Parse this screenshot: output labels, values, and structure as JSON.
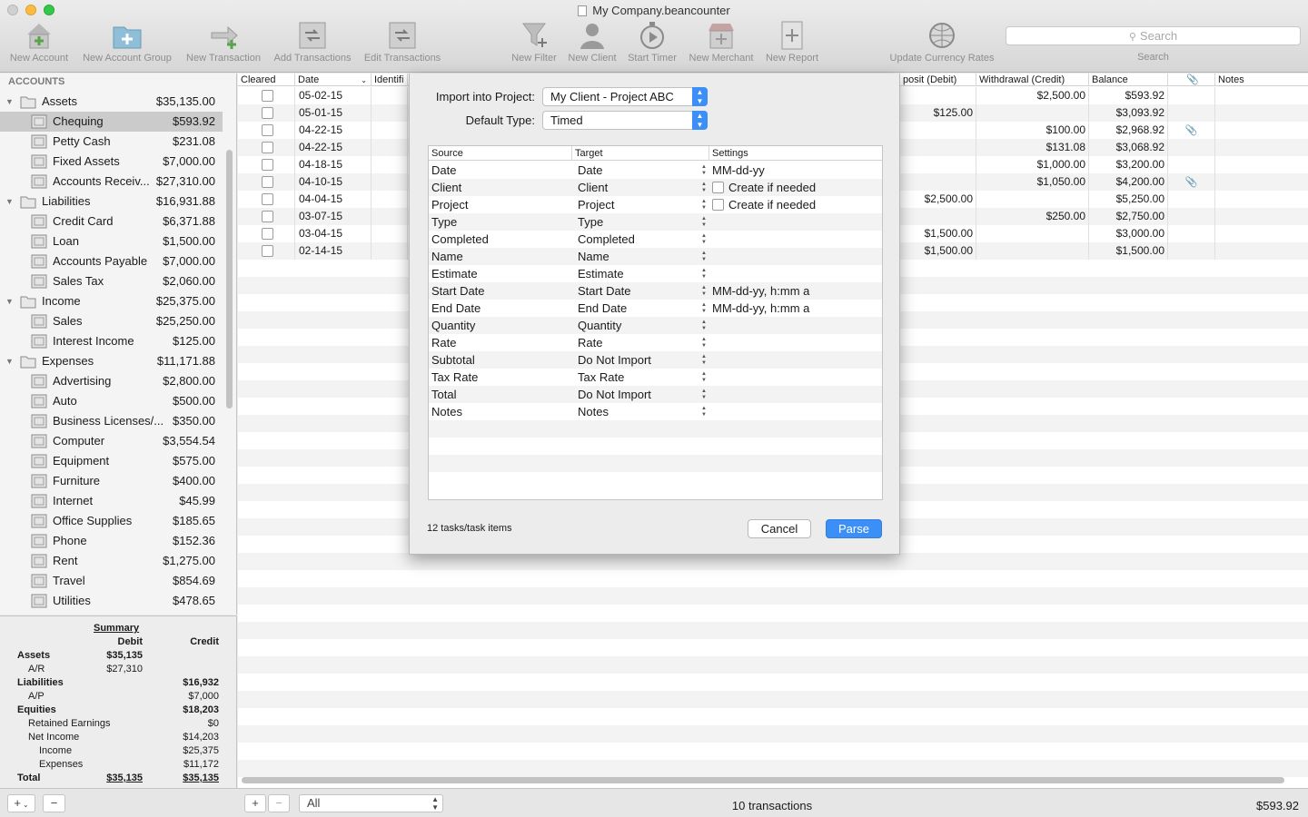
{
  "window": {
    "title": "My Company.beancounter"
  },
  "toolbar": {
    "items": [
      {
        "label": "New Account",
        "icon": "new-account-icon"
      },
      {
        "label": "New Account Group",
        "icon": "new-account-group-icon"
      },
      {
        "label": "New Transaction",
        "icon": "new-transaction-icon"
      },
      {
        "label": "Add Transactions",
        "icon": "add-transactions-icon"
      },
      {
        "label": "Edit Transactions",
        "icon": "edit-transactions-icon"
      },
      {
        "label": "New Filter",
        "icon": "new-filter-icon"
      },
      {
        "label": "New Client",
        "icon": "new-client-icon"
      },
      {
        "label": "Start Timer",
        "icon": "start-timer-icon"
      },
      {
        "label": "New Merchant",
        "icon": "new-merchant-icon"
      },
      {
        "label": "New Report",
        "icon": "new-report-icon"
      },
      {
        "label": "Update Currency Rates",
        "icon": "update-currency-rates-icon"
      }
    ],
    "search_placeholder": "Search",
    "search_label": "Search"
  },
  "sidebar": {
    "header": "ACCOUNTS",
    "accounts": [
      {
        "label": "Assets",
        "amount": "$35,135.00",
        "group": true
      },
      {
        "label": "Chequing",
        "amount": "$593.92",
        "selected": true
      },
      {
        "label": "Petty Cash",
        "amount": "$231.08"
      },
      {
        "label": "Fixed Assets",
        "amount": "$7,000.00"
      },
      {
        "label": "Accounts Receiv...",
        "amount": "$27,310.00"
      },
      {
        "label": "Liabilities",
        "amount": "$16,931.88",
        "group": true
      },
      {
        "label": "Credit Card",
        "amount": "$6,371.88"
      },
      {
        "label": "Loan",
        "amount": "$1,500.00"
      },
      {
        "label": "Accounts Payable",
        "amount": "$7,000.00"
      },
      {
        "label": "Sales Tax",
        "amount": "$2,060.00"
      },
      {
        "label": "Income",
        "amount": "$25,375.00",
        "group": true
      },
      {
        "label": "Sales",
        "amount": "$25,250.00"
      },
      {
        "label": "Interest Income",
        "amount": "$125.00"
      },
      {
        "label": "Expenses",
        "amount": "$11,171.88",
        "group": true
      },
      {
        "label": "Advertising",
        "amount": "$2,800.00"
      },
      {
        "label": "Auto",
        "amount": "$500.00"
      },
      {
        "label": "Business Licenses/...",
        "amount": "$350.00"
      },
      {
        "label": "Computer",
        "amount": "$3,554.54"
      },
      {
        "label": "Equipment",
        "amount": "$575.00"
      },
      {
        "label": "Furniture",
        "amount": "$400.00"
      },
      {
        "label": "Internet",
        "amount": "$45.99"
      },
      {
        "label": "Office Supplies",
        "amount": "$185.65"
      },
      {
        "label": "Phone",
        "amount": "$152.36"
      },
      {
        "label": "Rent",
        "amount": "$1,275.00"
      },
      {
        "label": "Travel",
        "amount": "$854.69"
      },
      {
        "label": "Utilities",
        "amount": "$478.65"
      }
    ]
  },
  "summary": {
    "title": "Summary",
    "debit_header": "Debit",
    "credit_header": "Credit",
    "rows": [
      {
        "label": "Assets",
        "debit": "$35,135",
        "credit": "",
        "bold": true,
        "level": 0
      },
      {
        "label": "A/R",
        "debit": "$27,310",
        "credit": "",
        "bold": false,
        "level": 1
      },
      {
        "label": "Liabilities",
        "debit": "",
        "credit": "$16,932",
        "bold": true,
        "level": 0
      },
      {
        "label": "A/P",
        "debit": "",
        "credit": "$7,000",
        "bold": false,
        "level": 1
      },
      {
        "label": "Equities",
        "debit": "",
        "credit": "$18,203",
        "bold": true,
        "level": 0
      },
      {
        "label": "Retained Earnings",
        "debit": "",
        "credit": "$0",
        "bold": false,
        "level": 1
      },
      {
        "label": "Net Income",
        "debit": "",
        "credit": "$14,203",
        "bold": false,
        "level": 1
      },
      {
        "label": "Income",
        "debit": "",
        "credit": "$25,375",
        "bold": false,
        "level": 2
      },
      {
        "label": "Expenses",
        "debit": "",
        "credit": "$11,172",
        "bold": false,
        "level": 2
      },
      {
        "label": "Total",
        "debit": "$35,135",
        "credit": "$35,135",
        "bold": true,
        "level": 0,
        "underline": true
      }
    ]
  },
  "register": {
    "columns": [
      "Cleared",
      "Date",
      "Identifi",
      "posit (Debit)",
      "Withdrawal (Credit)",
      "Balance",
      "",
      "Notes"
    ],
    "rows": [
      {
        "date": "05-02-15",
        "deposit": "",
        "withdrawal": "$2,500.00",
        "balance": "$593.92",
        "attach": false
      },
      {
        "date": "05-01-15",
        "deposit": "$125.00",
        "withdrawal": "",
        "balance": "$3,093.92",
        "attach": false
      },
      {
        "date": "04-22-15",
        "deposit": "",
        "withdrawal": "$100.00",
        "balance": "$2,968.92",
        "attach": true
      },
      {
        "date": "04-22-15",
        "deposit": "",
        "withdrawal": "$131.08",
        "balance": "$3,068.92",
        "attach": false
      },
      {
        "date": "04-18-15",
        "deposit": "",
        "withdrawal": "$1,000.00",
        "balance": "$3,200.00",
        "attach": false
      },
      {
        "date": "04-10-15",
        "deposit": "",
        "withdrawal": "$1,050.00",
        "balance": "$4,200.00",
        "attach": true
      },
      {
        "date": "04-04-15",
        "deposit": "$2,500.00",
        "withdrawal": "",
        "balance": "$5,250.00",
        "attach": false
      },
      {
        "date": "03-07-15",
        "deposit": "",
        "withdrawal": "$250.00",
        "balance": "$2,750.00",
        "attach": false
      },
      {
        "date": "03-04-15",
        "deposit": "$1,500.00",
        "withdrawal": "",
        "balance": "$3,000.00",
        "attach": false
      },
      {
        "date": "02-14-15",
        "deposit": "$1,500.00",
        "withdrawal": "",
        "balance": "$1,500.00",
        "attach": false
      }
    ]
  },
  "dialog": {
    "project_label": "Import into Project:",
    "project_value": "My Client - Project ABC",
    "type_label": "Default Type:",
    "type_value": "Timed",
    "columns": [
      "Source",
      "Target",
      "Settings"
    ],
    "rows": [
      {
        "source": "Date",
        "target": "Date",
        "setting": "MM-dd-yy",
        "checkbox": false
      },
      {
        "source": "Client",
        "target": "Client",
        "setting": "Create if needed",
        "checkbox": true
      },
      {
        "source": "Project",
        "target": "Project",
        "setting": "Create if needed",
        "checkbox": true
      },
      {
        "source": "Type",
        "target": "Type",
        "setting": "",
        "checkbox": false
      },
      {
        "source": "Completed",
        "target": "Completed",
        "setting": "",
        "checkbox": false
      },
      {
        "source": "Name",
        "target": "Name",
        "setting": "",
        "checkbox": false
      },
      {
        "source": "Estimate",
        "target": "Estimate",
        "setting": "",
        "checkbox": false
      },
      {
        "source": "Start Date",
        "target": "Start Date",
        "setting": "MM-dd-yy, h:mm a",
        "checkbox": false
      },
      {
        "source": "End Date",
        "target": "End Date",
        "setting": "MM-dd-yy, h:mm a",
        "checkbox": false
      },
      {
        "source": "Quantity",
        "target": "Quantity",
        "setting": "",
        "checkbox": false
      },
      {
        "source": "Rate",
        "target": "Rate",
        "setting": "",
        "checkbox": false
      },
      {
        "source": "Subtotal",
        "target": "Do Not Import",
        "setting": "",
        "checkbox": false
      },
      {
        "source": "Tax Rate",
        "target": "Tax Rate",
        "setting": "",
        "checkbox": false
      },
      {
        "source": "Total",
        "target": "Do Not Import",
        "setting": "",
        "checkbox": false
      },
      {
        "source": "Notes",
        "target": "Notes",
        "setting": "",
        "checkbox": false
      }
    ],
    "count_text": "12 tasks/task items",
    "cancel_label": "Cancel",
    "parse_label": "Parse"
  },
  "footer": {
    "add_label": "+",
    "remove_label": "−",
    "filter_value": "All",
    "transactions_text": "10 transactions",
    "balance_text": "$593.92"
  },
  "colors": {
    "accent": "#3b8ff6",
    "selection": "#cbcbcb",
    "close": "#fc605c",
    "minimize": "#fdbc40",
    "zoom": "#34c84a"
  }
}
